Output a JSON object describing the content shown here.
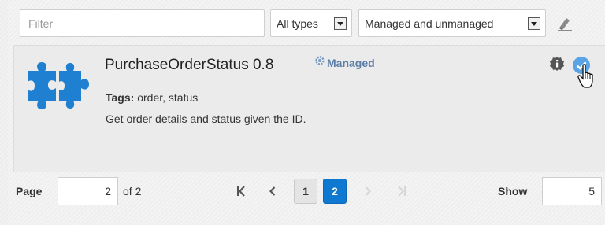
{
  "toolbar": {
    "filter_placeholder": "Filter",
    "type_select": "All types",
    "managed_select": "Managed and unmanaged",
    "clear_icon": "eraser-icon"
  },
  "card": {
    "icon": "puzzle-piece-icon",
    "title": "PurchaseOrderStatus 0.8",
    "status_label": "Managed",
    "tags_label": "Tags:",
    "tags_value": "order, status",
    "description": "Get order details and status given the ID.",
    "actions": [
      "info-icon",
      "check-circle-icon"
    ]
  },
  "pagination": {
    "page_label": "Page",
    "current_page": "2",
    "of_text": "of 2",
    "pages": [
      "1",
      "2"
    ],
    "selected_page": "2",
    "show_label": "Show",
    "show_value": "5"
  },
  "colors": {
    "accent": "#0f79d1",
    "managed_text": "#5a7ea8",
    "puzzle": "#1f7fd0"
  }
}
